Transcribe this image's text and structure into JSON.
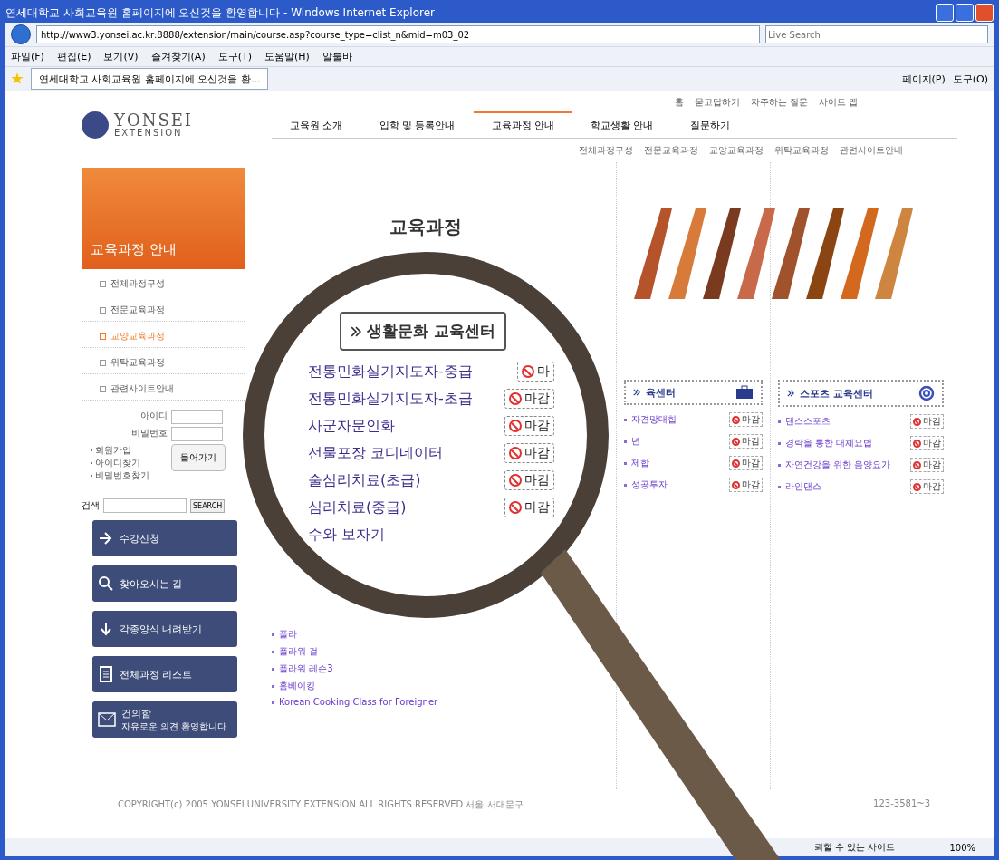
{
  "window": {
    "title": "연세대학교 사회교육원 홈페이지에 오신것을 환영합니다 - Windows Internet Explorer"
  },
  "address_bar": {
    "url": "http://www3.yonsei.ac.kr:8888/extension/main/course.asp?course_type=clist_n&mid=m03_02",
    "search_placeholder": "Live Search"
  },
  "menu_bar": [
    "파일(F)",
    "편집(E)",
    "보기(V)",
    "즐겨찾기(A)",
    "도구(T)",
    "도움말(H)"
  ],
  "toolbar": {
    "altoolbar": "알툴바"
  },
  "tab": {
    "title": "연세대학교 사회교육원 홈페이지에 오신것을 환..."
  },
  "command_bar": [
    "페이지(P)",
    "도구(O)"
  ],
  "site": {
    "top_links": [
      "홈",
      "묻고답하기",
      "자주하는 질문",
      "사이트 맵"
    ],
    "logo": {
      "name": "YONSEI",
      "sub": "EXTENSION"
    },
    "nav": [
      {
        "label": "교육원 소개",
        "selected": false
      },
      {
        "label": "입학 및 등록안내",
        "selected": false
      },
      {
        "label": "교육과정 안내",
        "selected": true
      },
      {
        "label": "학교생활 안내",
        "selected": false
      },
      {
        "label": "질문하기",
        "selected": false
      }
    ],
    "subnav": [
      "전체과정구성",
      "전문교육과정",
      "교양교육과정",
      "위탁교육과정",
      "관련사이트안내"
    ],
    "sidebar": {
      "banner": "교육과정 안내",
      "items": [
        {
          "label": "전체과정구성",
          "selected": false
        },
        {
          "label": "전문교육과정",
          "selected": false
        },
        {
          "label": "교양교육과정",
          "selected": true
        },
        {
          "label": "위탁교육과정",
          "selected": false
        },
        {
          "label": "관련사이트안내",
          "selected": false
        }
      ],
      "login": {
        "id_label": "아이디",
        "pw_label": "비밀번호",
        "button": "들어가기",
        "links": [
          "회원가입",
          "아이디찾기",
          "비밀번호찾기"
        ]
      },
      "search": {
        "label": "검색",
        "button": "SEARCH"
      },
      "quick_buttons": [
        {
          "kind": "apply",
          "label": "수강신청"
        },
        {
          "kind": "map",
          "label": "찾아오시는 길"
        },
        {
          "kind": "download",
          "label": "각종양식 내려받기"
        },
        {
          "kind": "list",
          "label": "전체과정 리스트"
        },
        {
          "kind": "mail",
          "label": "건의함",
          "sub": "자유로운 의견 환영합니다"
        }
      ]
    },
    "page_title": "교육과정",
    "centers": [
      {
        "title": "생활문화 교육센터",
        "courses": [
          {
            "name": "전통민화실기지도자-중급",
            "badge": "마"
          },
          {
            "name": "전통민화실기지도자-초급",
            "badge": "마감"
          },
          {
            "name": "사군자문인화",
            "badge": "마감"
          },
          {
            "name": "선물포장 코디네이터",
            "badge": "마감"
          },
          {
            "name": "술심리치료(초급)",
            "badge": "마감"
          },
          {
            "name": "심리치료(중급)",
            "badge": "마감"
          },
          {
            "name": "수와 보자기"
          }
        ],
        "more_courses": [
          "플라",
          "플라워 걸",
          "플라워 레슨3",
          "홈베이킹",
          "Korean Cooking Class for Foreigner"
        ]
      },
      {
        "title": "육센터",
        "courses": [
          {
            "name": "자견망대힙",
            "badge": "마감"
          },
          {
            "name": "년",
            "badge": "마감"
          },
          {
            "name": "제합",
            "badge": "마감"
          },
          {
            "name": "성공투자",
            "badge": "마감"
          }
        ]
      },
      {
        "title": "스포츠 교육센터",
        "courses": [
          {
            "name": "댄스스포츠",
            "badge": "마감"
          },
          {
            "name": "경락을 통한 대체요법",
            "badge": "마감"
          },
          {
            "name": "자연건강을 위한 음양요가",
            "badge": "마감"
          },
          {
            "name": "라인댄스",
            "badge": "마감"
          }
        ]
      }
    ],
    "footer": {
      "copyright": "COPYRIGHT(c) 2005 YONSEI UNIVERSITY EXTENSION ALL RIGHTS RESERVED  서울 서대문구",
      "phone": "123-3581~3"
    }
  },
  "status_bar": {
    "zone": "뢰할 수 있는 사이트",
    "zoom": "100%"
  }
}
